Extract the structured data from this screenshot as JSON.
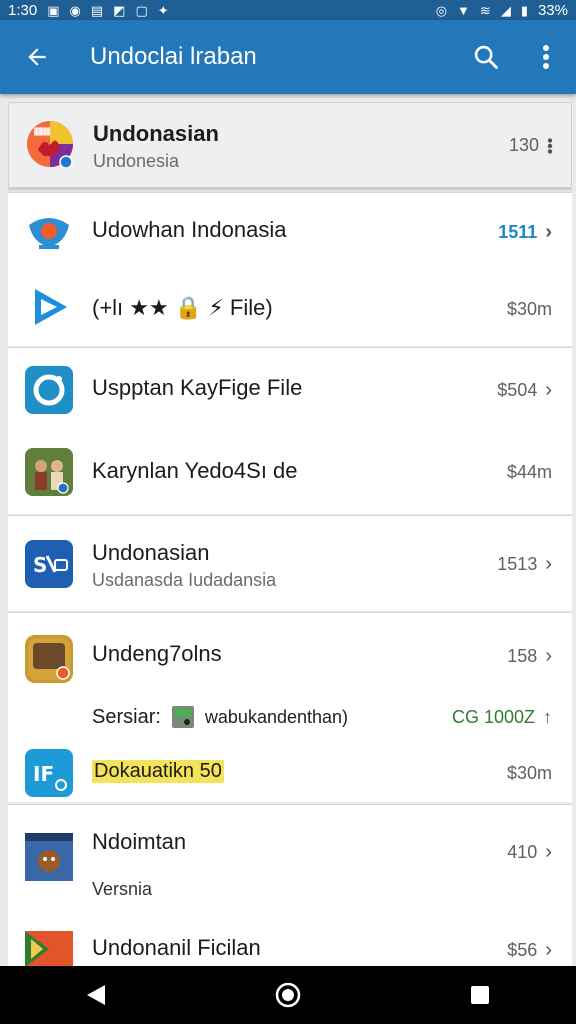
{
  "status_bar": {
    "time": "1:30",
    "battery": "33%",
    "left_icons": [
      "gallery-icon",
      "target-icon",
      "sim-icon",
      "nosignal-icon",
      "app-icon",
      "sparkle-icon"
    ],
    "right_icons": [
      "alarm-icon",
      "wifi-icon",
      "network-icon",
      "signal-icon",
      "battery-icon"
    ]
  },
  "app_bar": {
    "title": "Undoclai lraban",
    "back_icon": "arrow-left-icon",
    "search_icon": "search-icon",
    "menu_icon": "more-vertical-icon"
  },
  "featured": {
    "title": "Undonasian",
    "subtitle": "Undonesia",
    "meta": "130"
  },
  "sections": [
    {
      "items": [
        {
          "title": "Udowhan Indonasia",
          "meta": "1511",
          "chevron": true,
          "meta_color": "#1b87c9"
        },
        {
          "title": "(+lı ★★ 🔒 ⚡ File)",
          "meta": "$30m",
          "chevron": false
        }
      ]
    },
    {
      "items": [
        {
          "title": "Uspptan KayFige File",
          "meta": "$504",
          "chevron": true
        },
        {
          "title": "Karynlan Yedo4Sı de",
          "meta": "$44m",
          "chevron": false
        }
      ]
    },
    {
      "items": [
        {
          "title": "Undonasian",
          "subtitle": "Usdanasda Iudadansia",
          "meta": "1513",
          "chevron": true
        }
      ]
    },
    {
      "items": [
        {
          "title": "Undeng7olns",
          "meta": "158",
          "chevron": true
        },
        {
          "title": "Sersiar:",
          "detail": "wabukandenthan)",
          "meta": "CG 1000Z",
          "meta_extra": "↑",
          "chevron": false,
          "meta_color": "#2f7d32"
        },
        {
          "title": "Dokauatikn 50",
          "meta": "$30m",
          "chevron": false,
          "highlight": "#f3e25a"
        }
      ]
    },
    {
      "items": [
        {
          "title": "Ndoimtan",
          "subtitle": "Versnia",
          "meta": "410",
          "chevron": true
        },
        {
          "title": "Undonanil Ficilan",
          "meta": "$56",
          "chevron": true
        }
      ]
    }
  ],
  "nav_bar": {
    "back_icon": "nav-back-icon",
    "home_icon": "nav-home-icon",
    "recents_icon": "nav-recents-icon"
  },
  "colors": {
    "status_bar": "#1f5f95",
    "app_bar": "#2378ba",
    "accent_blue": "#1b87c9",
    "accent_green": "#2f7d32"
  }
}
